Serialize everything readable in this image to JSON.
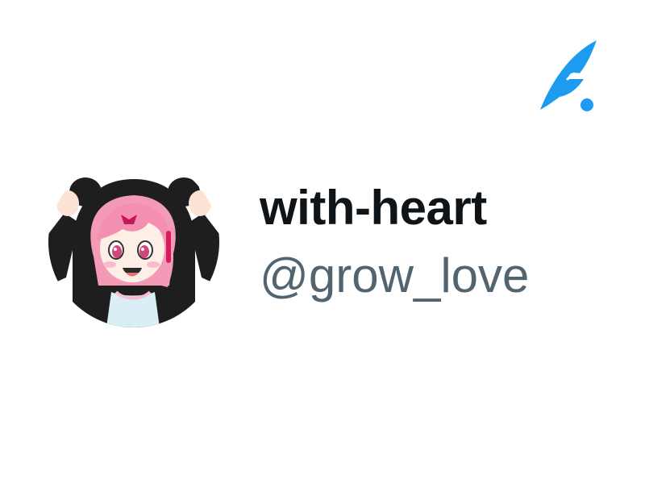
{
  "app": {
    "logo_icon": "quill-feather-icon",
    "brand_color": "#1d9bf0"
  },
  "profile": {
    "display_name": "with-heart",
    "handle": "@grow_love",
    "avatar_icon": "anime-avatar-image",
    "name_color": "#0f1419",
    "handle_color": "#536471"
  }
}
